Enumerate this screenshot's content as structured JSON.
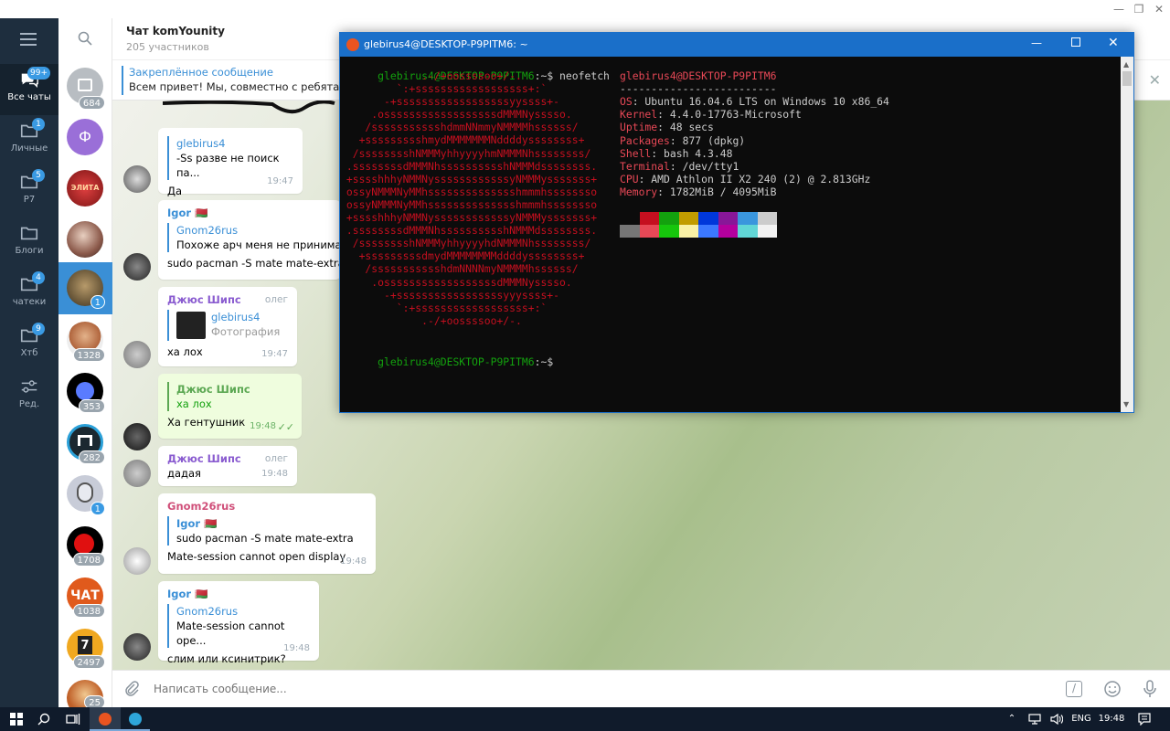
{
  "folders": [
    {
      "label": "Все чаты",
      "badge": "99+",
      "icon": "chat-bubbles-icon"
    },
    {
      "label": "Личные",
      "badge": "1",
      "icon": "folder-icon"
    },
    {
      "label": "P7",
      "badge": "5",
      "icon": "folder-icon"
    },
    {
      "label": "Блоги",
      "badge": "",
      "icon": "folder-icon"
    },
    {
      "label": "чатеки",
      "badge": "4",
      "icon": "folder-icon"
    },
    {
      "label": "Хтб",
      "badge": "9",
      "icon": "folder-icon"
    },
    {
      "label": "Ред.",
      "badge": "",
      "icon": "sliders-icon"
    }
  ],
  "chatlist": {
    "counts": [
      "684",
      "",
      "",
      "",
      "1",
      "1328",
      "353",
      "282",
      "1",
      "1708",
      "1038",
      "2497",
      "25"
    ],
    "avatar_letters": [
      "",
      "Ф",
      "ЭЛИТА",
      "",
      "",
      "",
      "",
      "",
      "",
      "",
      "ЧАТ",
      "7",
      ""
    ]
  },
  "chat": {
    "title": "Чат komYounity",
    "members": "205 участников",
    "pinned_title": "Закреплённое сообщение",
    "pinned_text": "Всем привет! Мы, совместно с ребятами из"
  },
  "messages": [
    {
      "reply_name": "glebirus4",
      "reply_text": "-Ss разве не поиск па...",
      "text": "Да",
      "time": "19:47"
    },
    {
      "sender": "Igor 🇧🇾",
      "reply_name": "Gnom26rus",
      "reply_text": "Похоже арч меня не принимает",
      "text": "sudo pacman -S mate mate-extra"
    },
    {
      "sender": "Джюс Шипс",
      "tag": "олег",
      "reply_name": "glebirus4",
      "reply_text": "Фотография",
      "text": "ха лох",
      "time": "19:47"
    },
    {
      "reply_name": "Джюс Шипс",
      "reply_text": "ха лох",
      "text": "Ха гентушник",
      "time": "19:48",
      "own": true
    },
    {
      "sender": "Джюс Шипс",
      "tag": "олег",
      "text": "дадая",
      "time": "19:48"
    },
    {
      "sender": "Gnom26rus",
      "reply_name": "Igor 🇧🇾",
      "reply_text": "sudo pacman -S mate mate-extra",
      "text": "Mate-session cannot open display",
      "time": "19:48"
    },
    {
      "sender": "Igor 🇧🇾",
      "reply_name": "Gnom26rus",
      "reply_text": "Mate-session cannot ope...",
      "text": "слим или ксинитрик?",
      "time": "19:48"
    }
  ],
  "composer": {
    "placeholder": "Написать сообщение..."
  },
  "terminal": {
    "title": "glebirus4@DESKTOP-P9PITM6: ~",
    "prompt_user": "glebirus4@DESKTOP-P9PITM6",
    "prompt_path": ":~$",
    "command": " neofetch",
    "host": "glebirus4@DESKTOP-P9PITM6",
    "separator": "-------------------------",
    "info": [
      {
        "k": "OS",
        "v": ": Ubuntu 16.04.6 LTS on Windows 10 x86_64"
      },
      {
        "k": "Kernel",
        "v": ": 4.4.0-17763-Microsoft"
      },
      {
        "k": "Uptime",
        "v": ": 48 secs"
      },
      {
        "k": "Packages",
        "v": ": 877 (dpkg)"
      },
      {
        "k": "Shell",
        "v": ": bash 4.3.48"
      },
      {
        "k": "Terminal",
        "v": ": /dev/tty1"
      },
      {
        "k": "CPU",
        "v": ": AMD Athlon II X2 240 (2) @ 2.813GHz"
      },
      {
        "k": "Memory",
        "v": ": 1782MiB / 4095MiB"
      }
    ],
    "ascii": [
      "             .-/+oossssoo+/-.",
      "         `:+ssssssssssssssssss+:`",
      "       -+ssssssssssssssssssyyssss+-",
      "     .ossssssssssssssssssdMMMNysssso.",
      "    /ssssssssssshdmmNNmmyNMMMMhssssss/",
      "   +ssssssssshmydMMMMMMMNddddyssssssss+",
      "  /sssssssshNMMMyhhyyyyhmNMMMNhssssssss/",
      " .ssssssssdMMMNhsssssssssshNMMMdssssssss.",
      " +sssshhhyNMMNyssssssssssssyNMMMysssssss+",
      " ossyNMMMNyMMhsssssssssssssshmmmhssssssso",
      " ossyNMMMNyMMhsssssssssssssshmmmhssssssso",
      " +sssshhhyNMMNyssssssssssssyNMMMysssssss+",
      " .ssssssssdMMMNhsssssssssshNMMMdssssssss.",
      "  /sssssssshNMMMyhhyyyyhdNMMMNhssssssss/",
      "   +sssssssssdmydMMMMMMMMddddyssssssss+",
      "    /ssssssssssshdmNNNNmyNMMMMhssssss/",
      "     .ossssssssssssssssssdMMMNysssso.",
      "       -+sssssssssssssssssyyyssss+-",
      "         `:+ssssssssssssssssss+:`",
      "             .-/+oossssoo+/-."
    ],
    "palette_top": [
      "#0c0c0c",
      "#c50f1f",
      "#13a10e",
      "#c19c00",
      "#0037da",
      "#881798",
      "#3a96dd",
      "#cccccc"
    ],
    "palette_bottom": [
      "#767676",
      "#e74856",
      "#16c60c",
      "#f9f1a5",
      "#3b78ff",
      "#b4009e",
      "#61d6d6",
      "#f2f2f2"
    ]
  },
  "taskbar": {
    "lang": "ENG",
    "time": "19:48"
  }
}
